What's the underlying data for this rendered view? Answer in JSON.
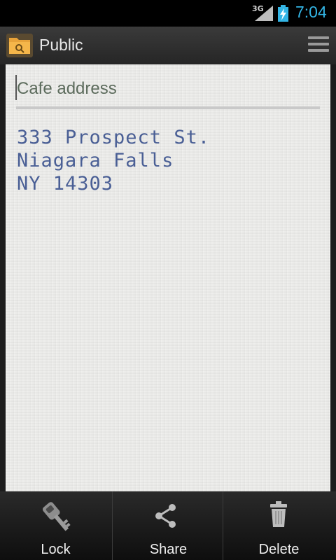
{
  "status_bar": {
    "network": "3G",
    "time": "7:04"
  },
  "action_bar": {
    "title": "Public"
  },
  "note": {
    "title": "Cafe address",
    "body_lines": [
      "333 Prospect St.",
      "Niagara Falls",
      "NY 14303"
    ]
  },
  "bottom_bar": {
    "lock_label": "Lock",
    "share_label": "Share",
    "delete_label": "Delete"
  },
  "colors": {
    "time": "#33b5e5",
    "note_text": "#4a5f95",
    "title_text": "#5c6b5c"
  }
}
